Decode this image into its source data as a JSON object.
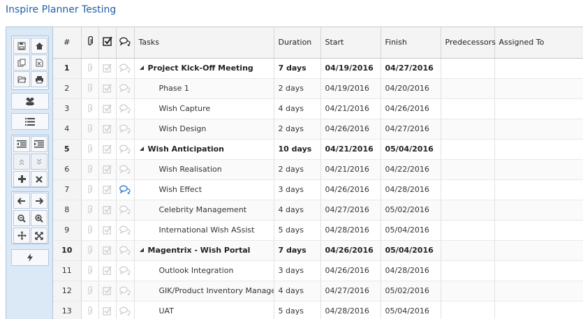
{
  "app": {
    "title": "Inspire Planner Testing"
  },
  "toolbar": {
    "buttons": [
      "save-icon",
      "home-icon",
      "copy-icon",
      "excel-export-icon",
      "open-folder-icon",
      "print-icon",
      "resources-icon",
      "list-icon",
      "outdent-icon",
      "indent-icon",
      "move-up-icon",
      "move-down-icon",
      "add-icon",
      "delete-icon",
      "arrow-left-icon",
      "arrow-right-icon",
      "zoom-out-icon",
      "zoom-in-icon",
      "pan-icon",
      "fit-icon",
      "critical-path-icon"
    ]
  },
  "grid": {
    "headers": {
      "num": "#",
      "attach": "paperclip-icon",
      "done": "checkbox-icon",
      "comments": "chat-icon",
      "tasks": "Tasks",
      "duration": "Duration",
      "start": "Start",
      "finish": "Finish",
      "predecessors": "Predecessors",
      "assigned": "Assigned To"
    },
    "rows": [
      {
        "num": "1",
        "task": "Project Kick-Off Meeting",
        "duration": "7 days",
        "start": "04/19/2016",
        "finish": "04/27/2016",
        "predecessors": "",
        "assigned": "",
        "summary": true,
        "comment_active": false
      },
      {
        "num": "2",
        "task": "Phase 1",
        "duration": "2 days",
        "start": "04/19/2016",
        "finish": "04/20/2016",
        "predecessors": "",
        "assigned": "",
        "summary": false,
        "comment_active": false
      },
      {
        "num": "3",
        "task": "Wish Capture",
        "duration": "4 days",
        "start": "04/21/2016",
        "finish": "04/26/2016",
        "predecessors": "",
        "assigned": "",
        "summary": false,
        "comment_active": false
      },
      {
        "num": "4",
        "task": "Wish Design",
        "duration": "2 days",
        "start": "04/26/2016",
        "finish": "04/27/2016",
        "predecessors": "",
        "assigned": "",
        "summary": false,
        "comment_active": false
      },
      {
        "num": "5",
        "task": "Wish Anticipation",
        "duration": "10 days",
        "start": "04/21/2016",
        "finish": "05/04/2016",
        "predecessors": "",
        "assigned": "",
        "summary": true,
        "comment_active": false
      },
      {
        "num": "6",
        "task": "Wish Realisation",
        "duration": "2 days",
        "start": "04/21/2016",
        "finish": "04/22/2016",
        "predecessors": "",
        "assigned": "",
        "summary": false,
        "comment_active": false
      },
      {
        "num": "7",
        "task": "Wish Effect",
        "duration": "3 days",
        "start": "04/26/2016",
        "finish": "04/28/2016",
        "predecessors": "",
        "assigned": "",
        "summary": false,
        "comment_active": true
      },
      {
        "num": "8",
        "task": "Celebrity Management",
        "duration": "4 days",
        "start": "04/27/2016",
        "finish": "05/02/2016",
        "predecessors": "",
        "assigned": "",
        "summary": false,
        "comment_active": false
      },
      {
        "num": "9",
        "task": "International Wish ASsist",
        "duration": "5 days",
        "start": "04/28/2016",
        "finish": "05/04/2016",
        "predecessors": "",
        "assigned": "",
        "summary": false,
        "comment_active": false
      },
      {
        "num": "10",
        "task": "Magentrix - Wish Portal",
        "duration": "7 days",
        "start": "04/26/2016",
        "finish": "05/04/2016",
        "predecessors": "",
        "assigned": "",
        "summary": true,
        "comment_active": false
      },
      {
        "num": "11",
        "task": "Outlook Integration",
        "duration": "3 days",
        "start": "04/26/2016",
        "finish": "04/28/2016",
        "predecessors": "",
        "assigned": "",
        "summary": false,
        "comment_active": false
      },
      {
        "num": "12",
        "task": "GIK/Product Inventory Managem",
        "duration": "4 days",
        "start": "04/27/2016",
        "finish": "05/02/2016",
        "predecessors": "",
        "assigned": "",
        "summary": false,
        "comment_active": false
      },
      {
        "num": "13",
        "task": "UAT",
        "duration": "5 days",
        "start": "04/28/2016",
        "finish": "05/04/2016",
        "predecessors": "",
        "assigned": "",
        "summary": false,
        "comment_active": false
      }
    ]
  },
  "colors": {
    "title": "#1f5fa8",
    "toolbar_bg": "#dbe9f7",
    "comment_active": "#2b78d6",
    "icon_inactive": "#c9c9c9"
  }
}
